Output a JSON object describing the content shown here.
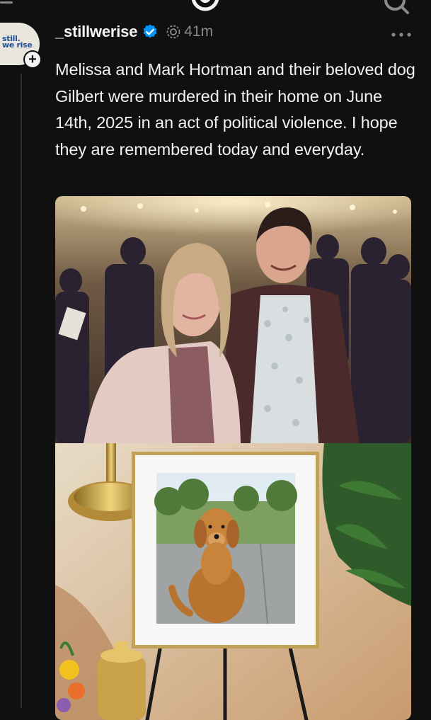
{
  "app": {
    "icons": {
      "menu": "menu-icon",
      "logo": "threads-logo-icon",
      "search": "search-icon"
    }
  },
  "post": {
    "avatar": {
      "text": "still.\nwe rise",
      "follow_symbol": "+"
    },
    "username": "_stillwerise",
    "verified": true,
    "timestamp": "41m",
    "caption": "Melissa and Mark Hortman and their beloved dog Gilbert were murdered in their home on June 14th, 2025 in an act of political violence. I hope they are remembered today and everyday.",
    "media": [
      {
        "kind": "photo",
        "subject": "couple"
      },
      {
        "kind": "photo",
        "subject": "dog"
      }
    ]
  },
  "colors": {
    "background": "#101010",
    "text": "#f3f3f3",
    "muted": "#8a8a8a",
    "verified": "#0095f6"
  }
}
